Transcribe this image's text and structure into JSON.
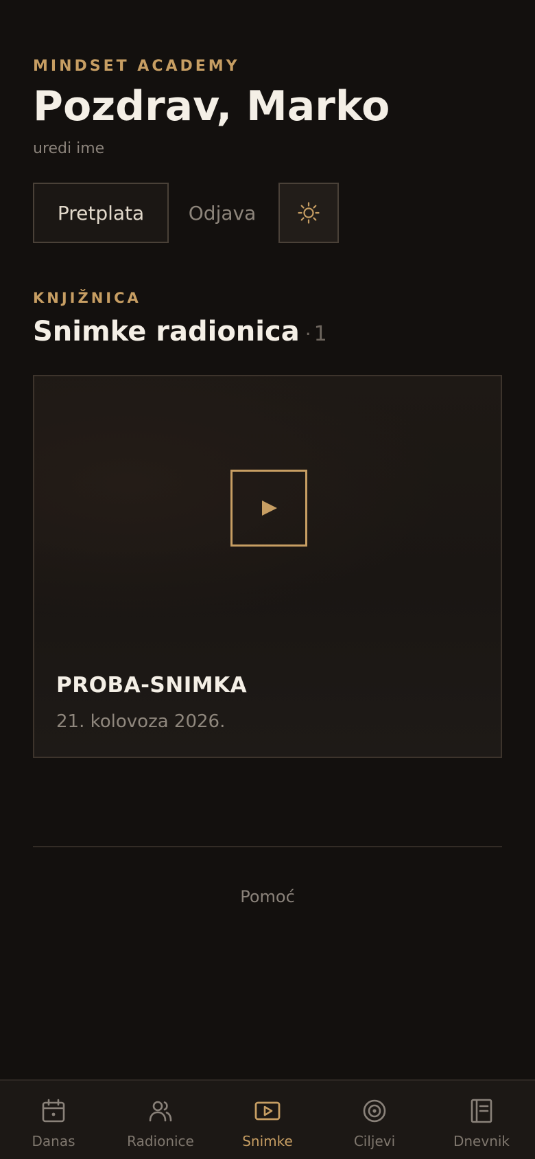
{
  "header": {
    "brand": "MINDSET ACADEMY",
    "greeting": "Pozdrav, Marko",
    "edit_name_link": "uredi ime"
  },
  "actions": {
    "subscription_label": "Pretplata",
    "logout_label": "Odjava",
    "theme_icon": "sun-icon"
  },
  "library": {
    "section_label": "KNJIŽNICA",
    "title": "Snimke radionica",
    "separator": "·",
    "count": "1",
    "recordings": [
      {
        "title": "PROBA-SNIMKA",
        "date": "21. kolovoza 2026.",
        "icon": "play-icon"
      }
    ]
  },
  "footer": {
    "help_link": "Pomoć"
  },
  "tabbar": {
    "items": [
      {
        "label": "Danas",
        "icon": "calendar-icon",
        "active": false
      },
      {
        "label": "Radionice",
        "icon": "users-icon",
        "active": false
      },
      {
        "label": "Snimke",
        "icon": "video-icon",
        "active": true
      },
      {
        "label": "Ciljevi",
        "icon": "target-icon",
        "active": false
      },
      {
        "label": "Dnevnik",
        "icon": "journal-icon",
        "active": false
      }
    ]
  },
  "colors": {
    "background": "#13100e",
    "accent": "#c79e63",
    "text": "#f4efe6",
    "muted": "#8a827a"
  }
}
